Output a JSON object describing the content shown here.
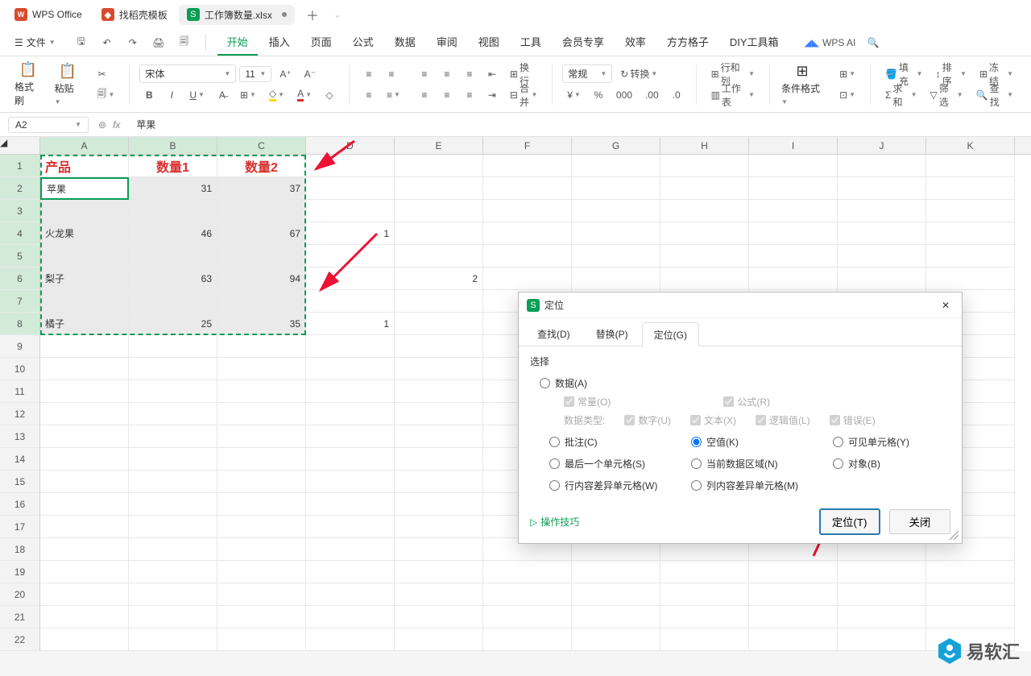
{
  "tabs": {
    "wps": "WPS Office",
    "template": "找稻壳模板",
    "workbook": "工作簿数量.xlsx"
  },
  "file_button": "文件",
  "menu": {
    "start": "开始",
    "insert": "插入",
    "layout": "页面",
    "formula": "公式",
    "data": "数据",
    "review": "审阅",
    "view": "视图",
    "tools": "工具",
    "member": "会员专享",
    "efficiency": "效率",
    "square": "方方格子",
    "diy": "DIY工具箱"
  },
  "wps_ai": "WPS AI",
  "ribbon": {
    "format_painter": "格式刷",
    "paste": "粘贴",
    "font_name": "宋体",
    "font_size": "11",
    "wrap": "换行",
    "merge": "合并",
    "number_format": "常规",
    "convert": "转换",
    "rowcol": "行和列",
    "sheet": "工作表",
    "cond_fmt": "条件格式",
    "fill": "填充",
    "sort": "排序",
    "freeze": "冻结",
    "sum": "求和",
    "filter": "筛选",
    "find": "查找"
  },
  "name_box": "A2",
  "formula": "苹果",
  "columns": [
    "A",
    "B",
    "C",
    "D",
    "E",
    "F",
    "G",
    "H",
    "I",
    "J",
    "K"
  ],
  "row_count": 22,
  "headers": {
    "a": "产品",
    "b": "数量1",
    "c": "数量2"
  },
  "table": [
    {
      "a": "苹果",
      "b": "31",
      "c": "37"
    },
    {
      "a": "",
      "b": "",
      "c": ""
    },
    {
      "a": "火龙果",
      "b": "46",
      "c": "67"
    },
    {
      "a": "",
      "b": "",
      "c": ""
    },
    {
      "a": "梨子",
      "b": "63",
      "c": "94"
    },
    {
      "a": "",
      "b": "",
      "c": ""
    },
    {
      "a": "橘子",
      "b": "25",
      "c": "35"
    }
  ],
  "outside": {
    "d4": "1",
    "e6": "2",
    "d8": "1"
  },
  "dialog": {
    "title": "定位",
    "tabs": {
      "find": "查找(D)",
      "replace": "替换(P)",
      "goto": "定位(G)"
    },
    "select_label": "选择",
    "radio": {
      "data": "数据(A)",
      "comment": "批注(C)",
      "blank": "空值(K)",
      "visible": "可见单元格(Y)",
      "last": "最后一个单元格(S)",
      "cur_region": "当前数据区域(N)",
      "object": "对象(B)",
      "row_diff": "行内容差异单元格(W)",
      "col_diff": "列内容差异单元格(M)"
    },
    "data_sub": {
      "const": "常量(O)",
      "formula": "公式(R)",
      "type_label": "数据类型:",
      "num": "数字(U)",
      "txt": "文本(X)",
      "logic": "逻辑值(L)",
      "err": "错误(E)"
    },
    "tips": "操作技巧",
    "ok": "定位(T)",
    "close": "关闭"
  },
  "brand": "易软汇"
}
